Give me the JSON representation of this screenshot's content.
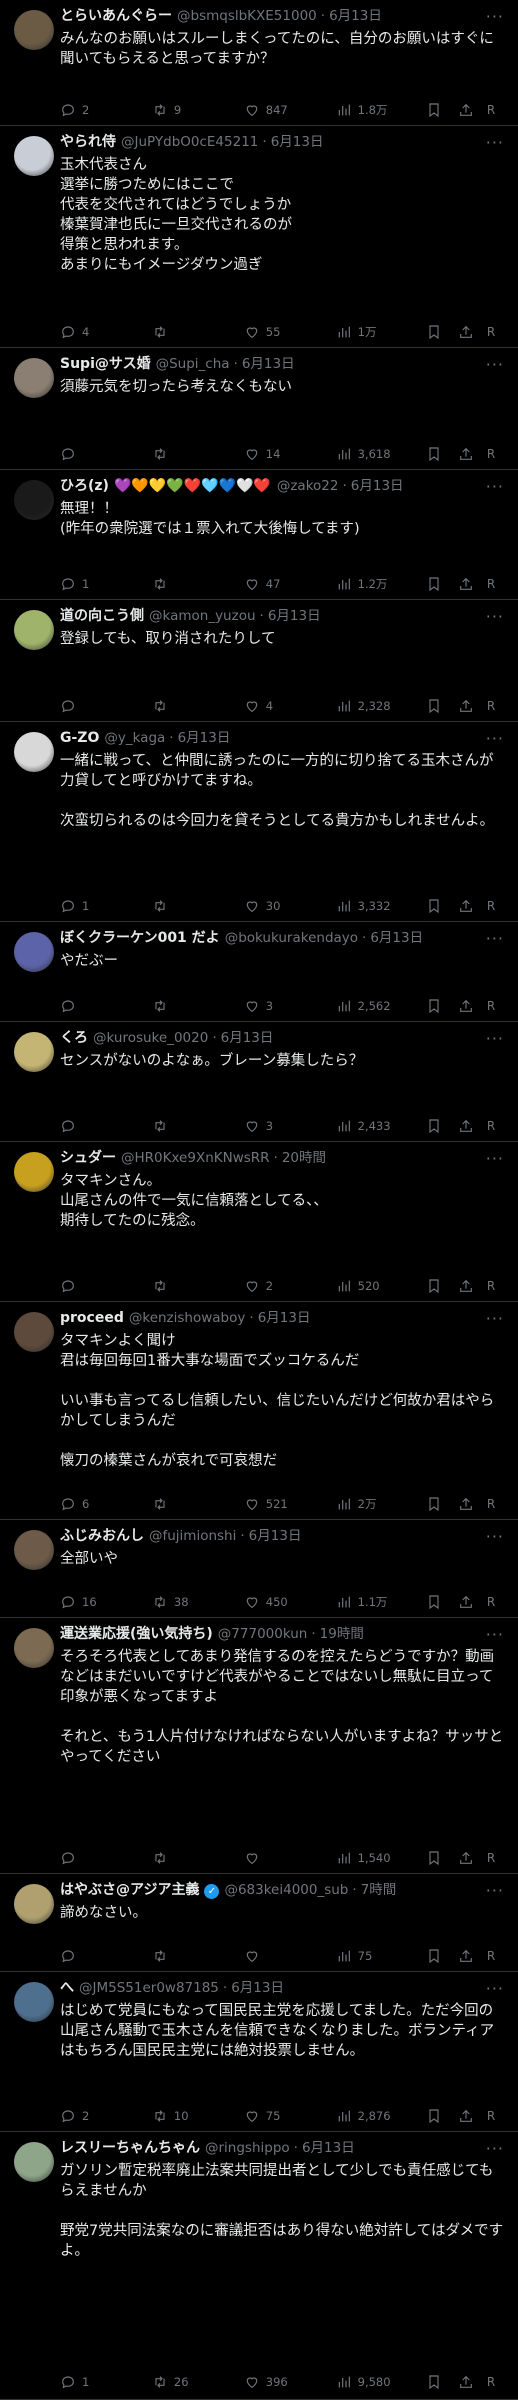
{
  "tweets": [
    {
      "name": "とらいあんぐらー",
      "handle": "@bsmqslbKXE51000",
      "date": "6月13日",
      "text": "みんなのお願いはスルーしまくってたのに、自分のお願いはすぐに聞いてもらえると思ってますか？",
      "replies": "2",
      "retweets": "9",
      "likes": "847",
      "views": "1.8万"
    },
    {
      "name": "やられ侍",
      "handle": "@JuPYdbO0cE45211",
      "date": "6月13日",
      "text": "玉木代表さん\n選挙に勝つためにはここで\n代表を交代されてはどうでしょうか\n榛葉賀津也氏に一旦交代されるのが\n得策と思われます。\nあまりにもイメージダウン過ぎ",
      "replies": "4",
      "retweets": "",
      "likes": "55",
      "views": "1万"
    },
    {
      "name": "Supi@サス婚",
      "handle": "@Supi_cha",
      "date": "6月13日",
      "text": "須藤元気を切ったら考えなくもない",
      "replies": "",
      "retweets": "",
      "likes": "14",
      "views": "3,618"
    },
    {
      "name": "ひろ(z)",
      "emojis": "💜🧡💛💚❤️🩵💙🤍❤️",
      "handle": "@zako22",
      "date": "6月13日",
      "text": "無理！！\n(昨年の衆院選では１票入れて大後悔してます)",
      "replies": "1",
      "retweets": "",
      "likes": "47",
      "views": "1.2万"
    },
    {
      "name": "道の向こう側",
      "handle": "@kamon_yuzou",
      "date": "6月13日",
      "text": "登録しても、取り消されたりして",
      "replies": "",
      "retweets": "",
      "likes": "4",
      "views": "2,328"
    },
    {
      "name": "G-ZO",
      "handle": "@y_kaga",
      "date": "6月13日",
      "text": "一緒に戦って、と仲間に誘ったのに一方的に切り捨てる玉木さんが力貸してと呼びかけてますね。\n\n次蛮切られるのは今回力を貸そうとしてる貴方かもしれませんよ。",
      "replies": "1",
      "retweets": "",
      "likes": "30",
      "views": "3,332"
    },
    {
      "name": "ぼくクラーケン001 だよ",
      "handle": "@bokukurakendayo",
      "date": "6月13日",
      "text": "やだぶー",
      "replies": "",
      "retweets": "",
      "likes": "3",
      "views": "2,562"
    },
    {
      "name": "くろ",
      "handle": "@kurosuke_0020",
      "date": "6月13日",
      "text": "センスがないのよなぁ。ブレーン募集したら？",
      "replies": "",
      "retweets": "",
      "likes": "3",
      "views": "2,433"
    },
    {
      "name": "シュダー",
      "handle": "@HR0Kxe9XnKNwsRR",
      "date": "20時間",
      "text": "タマキンさん。\n山尾さんの件で一気に信頼落としてる、、\n期待してたのに残念。",
      "replies": "",
      "retweets": "",
      "likes": "2",
      "views": "520"
    },
    {
      "name": "proceed",
      "handle": "@kenzishowaboy",
      "date": "6月13日",
      "text": "タマキンよく聞け\n君は毎回毎回1番大事な場面でズッコケるんだ\n\nいい事も言ってるし信頼したい、信じたいんだけど何故か君はやらかしてしまうんだ\n\n懐刀の榛葉さんが哀れで可哀想だ",
      "replies": "6",
      "retweets": "",
      "likes": "521",
      "views": "2万"
    },
    {
      "name": "ふじみおんし",
      "handle": "@fujimionshi",
      "date": "6月13日",
      "text": "全部いや",
      "replies": "16",
      "retweets": "38",
      "likes": "450",
      "views": "1.1万"
    },
    {
      "name": "運送業応援(強い気持ち)",
      "handle": "@777000kun",
      "date": "19時間",
      "text": "そろそろ代表としてあまり発信するのを控えたらどうですか？動画などはまだいいですけど代表がやることではないし無駄に目立って印象が悪くなってますよ\n\nそれと、もう1人片付けなければならない人がいますよね？サッサとやってください",
      "replies": "",
      "retweets": "",
      "likes": "",
      "views": "1,540"
    },
    {
      "name": "はやぶさ@アジア主義",
      "verified": true,
      "handle": "@683kei4000_sub",
      "date": "7時間",
      "text": "諦めなさい。",
      "replies": "",
      "retweets": "",
      "likes": "",
      "views": "75"
    },
    {
      "name": "へ",
      "handle": "@JM5S51er0w87185",
      "date": "6月13日",
      "text": "はじめて党員にもなって国民民主党を応援してました。ただ今回の山尾さん騒動で玉木さんを信頼できなくなりました。ボランティアはもちろん国民民主党には絶対投票しません。",
      "replies": "2",
      "retweets": "10",
      "likes": "75",
      "views": "2,876"
    },
    {
      "name": "レスリーちゃんちゃん",
      "handle": "@ringshippo",
      "date": "6月13日",
      "text": "ガソリン暫定税率廃止法案共同提出者として少しでも責任感じてもらえませんか\n\n野党7党共同法案なのに審議拒否はあり得ない絶対許してはダメですよ。",
      "replies": "1",
      "retweets": "26",
      "likes": "396",
      "views": "9,580"
    }
  ],
  "icons": {
    "reply": "reply-icon",
    "retweet": "retweet-icon",
    "like": "like-icon",
    "views": "views-icon",
    "bookmark": "bookmark-icon",
    "share": "share-icon",
    "translate": "translate-icon",
    "more": "more-icon"
  },
  "translate_label": "R",
  "more_label": "···",
  "colors": {
    "background": "#000000",
    "text": "#e7e9ea",
    "muted": "#71767b",
    "divider": "#2f3336",
    "verified": "#1d9bf0"
  }
}
